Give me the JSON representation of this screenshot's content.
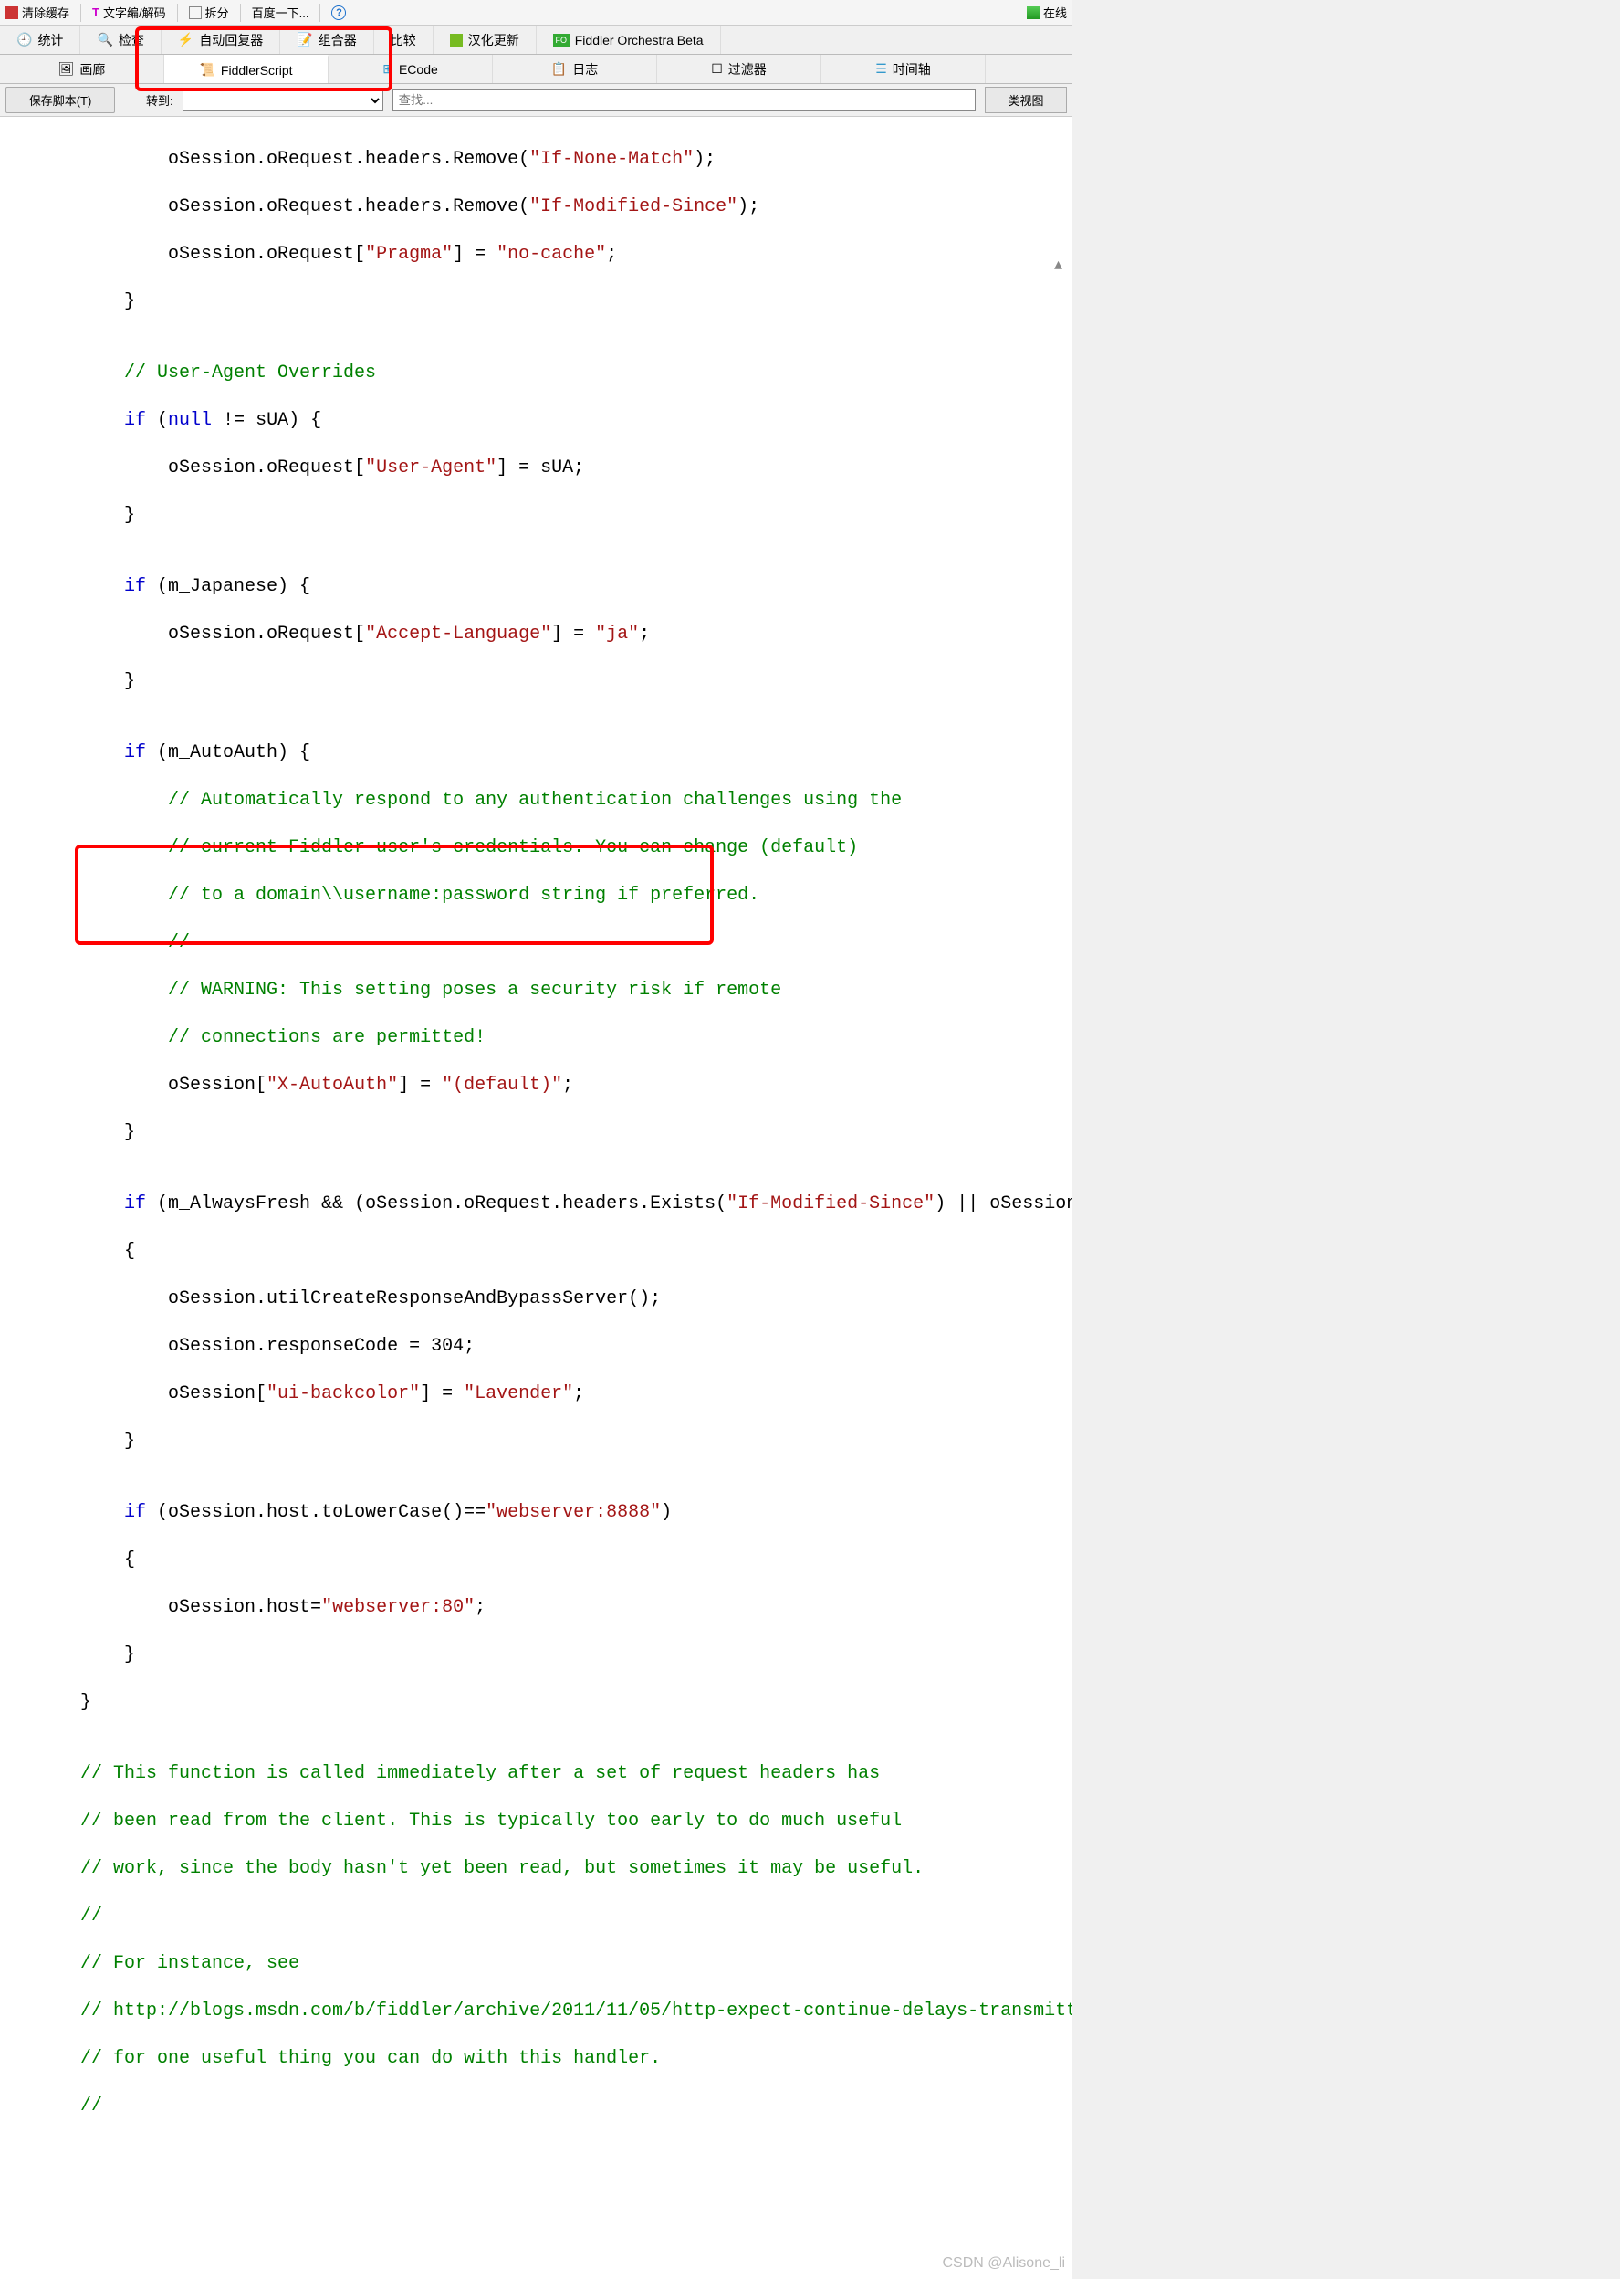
{
  "top_toolbar": {
    "clear_cache": "清除缓存",
    "text_encode": "文字编/解码",
    "split": "拆分",
    "baidu": "百度一下...",
    "help": "?",
    "online": "在线"
  },
  "tabs_row1": {
    "stats": "统计",
    "inspect": "检查",
    "autoresp": "自动回复器",
    "composer": "组合器",
    "compare": "比较",
    "hanhua": "汉化更新",
    "orchestra": "Fiddler Orchestra Beta"
  },
  "tabs_row2": {
    "gallery": "画廊",
    "fiddlerscript": "FiddlerScript",
    "ecode": "ECode",
    "log": "日志",
    "filter": "过滤器",
    "timeline": "时间轴"
  },
  "sub_toolbar": {
    "save": "保存脚本(T)",
    "goto_label": "转到:",
    "search_placeholder": "查找...",
    "classview": "类视图"
  },
  "code": {
    "l1a": "            oSession.oRequest.headers.Remove(",
    "l1b": "\"If-None-Match\"",
    "l1c": ");",
    "l2a": "            oSession.oRequest.headers.Remove(",
    "l2b": "\"If-Modified-Since\"",
    "l2c": ");",
    "l3a": "            oSession.oRequest[",
    "l3b": "\"Pragma\"",
    "l3c": "] = ",
    "l3d": "\"no-cache\"",
    "l3e": ";",
    "l4": "        }",
    "l5": "",
    "l6": "        // User-Agent Overrides",
    "l7a": "        if",
    "l7b": " (",
    "l7c": "null",
    "l7d": " != sUA) {",
    "l8a": "            oSession.oRequest[",
    "l8b": "\"User-Agent\"",
    "l8c": "] = sUA;",
    "l9": "        }",
    "l10": "",
    "l11a": "        if",
    "l11b": " (m_Japanese) {",
    "l12a": "            oSession.oRequest[",
    "l12b": "\"Accept-Language\"",
    "l12c": "] = ",
    "l12d": "\"ja\"",
    "l12e": ";",
    "l13": "        }",
    "l14": "",
    "l15a": "        if",
    "l15b": " (m_AutoAuth) {",
    "l16": "            // Automatically respond to any authentication challenges using the",
    "l17": "            // current Fiddler user's credentials. You can change (default)",
    "l18": "            // to a domain\\\\username:password string if preferred.",
    "l19": "            //",
    "l20": "            // WARNING: This setting poses a security risk if remote",
    "l21": "            // connections are permitted!",
    "l22a": "            oSession[",
    "l22b": "\"X-AutoAuth\"",
    "l22c": "] = ",
    "l22d": "\"(default)\"",
    "l22e": ";",
    "l23": "        }",
    "l24": "",
    "l25a": "        if",
    "l25b": " (m_AlwaysFresh && (oSession.oRequest.headers.Exists(",
    "l25c": "\"If-Modified-Since\"",
    "l25d": ") || oSession.",
    "l26": "        {",
    "l27": "            oSession.utilCreateResponseAndBypassServer();",
    "l28a": "            oSession.responseCode = ",
    "l28b": "304",
    "l28c": ";",
    "l29a": "            oSession[",
    "l29b": "\"ui-backcolor\"",
    "l29c": "] = ",
    "l29d": "\"Lavender\"",
    "l29e": ";",
    "l30": "        }",
    "l31": "",
    "l32a": "        if",
    "l32b": " (oSession.host.toLowerCase()==",
    "l32c": "\"webserver:8888\"",
    "l32d": ")",
    "l33": "        {",
    "l34a": "            oSession.host=",
    "l34b": "\"webserver:80\"",
    "l34c": ";",
    "l35": "        }",
    "l36": "    }",
    "l37": "",
    "l38": "    // This function is called immediately after a set of request headers has",
    "l39": "    // been read from the client. This is typically too early to do much useful",
    "l40": "    // work, since the body hasn't yet been read, but sometimes it may be useful.",
    "l41": "    //",
    "l42": "    // For instance, see",
    "l43": "    // http://blogs.msdn.com/b/fiddler/archive/2011/11/05/http-expect-continue-delays-transmitt",
    "l44": "    // for one useful thing you can do with this handler.",
    "l45": "    //"
  },
  "watermark": "CSDN @Alisone_li"
}
